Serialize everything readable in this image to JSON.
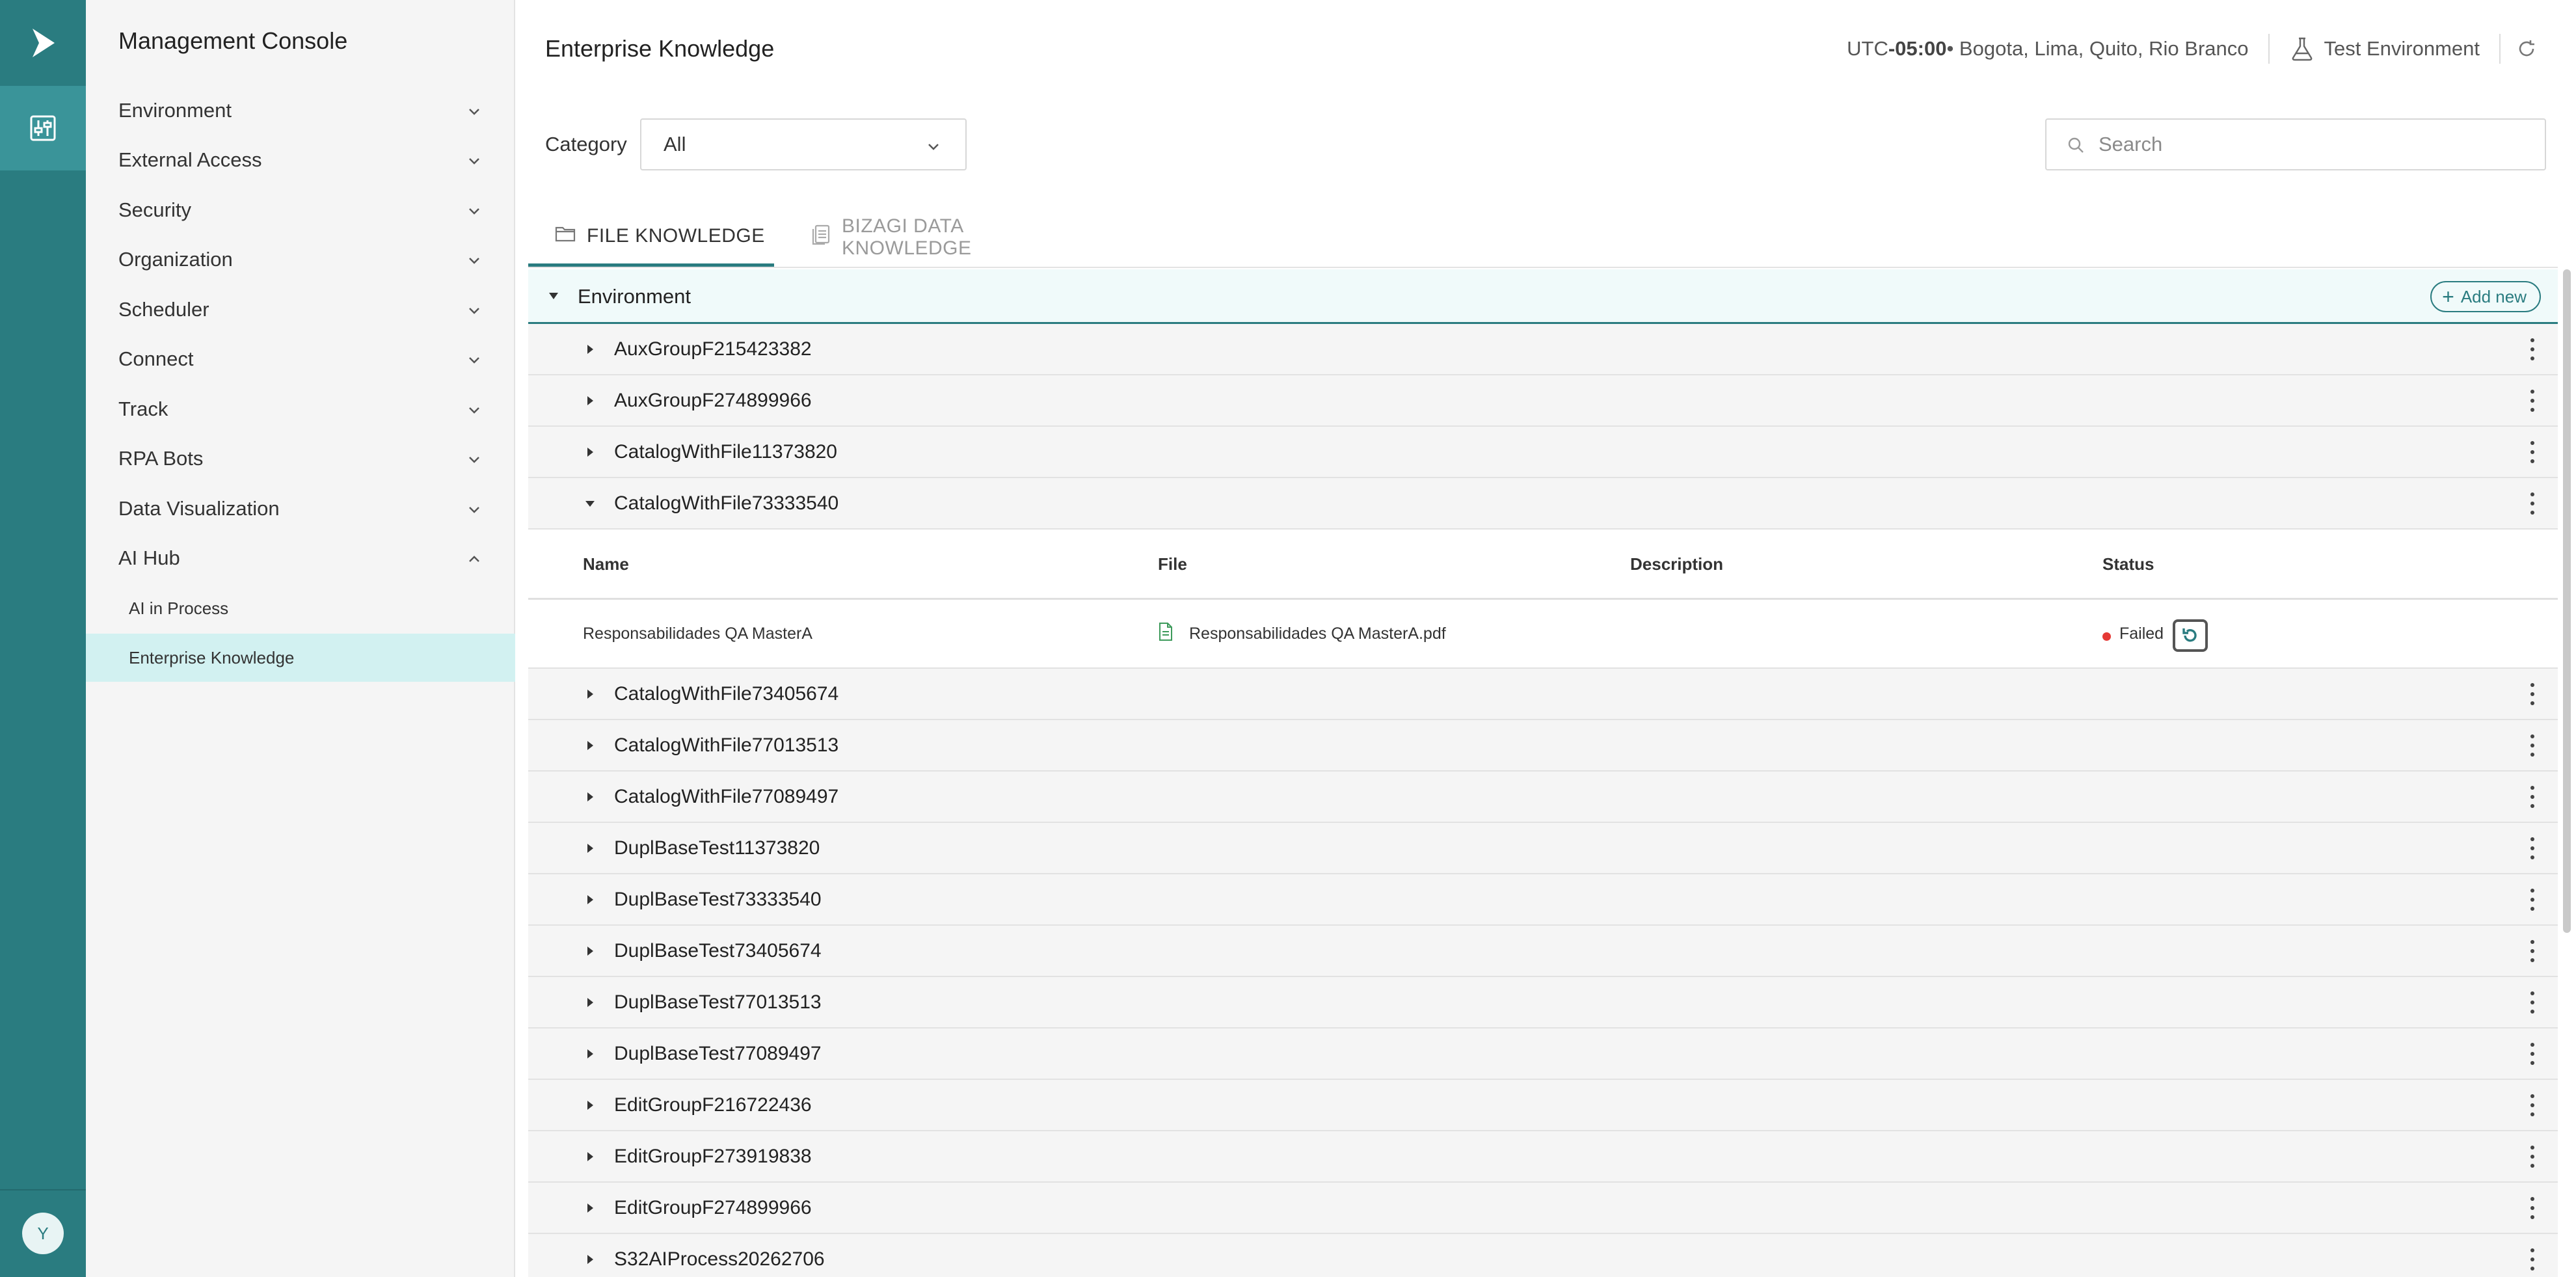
{
  "app": {
    "console_title": "Management Console",
    "avatar_initial": "Y",
    "accent_color": "#2a7c80"
  },
  "sidebar": {
    "items": [
      {
        "label": "Environment"
      },
      {
        "label": "External Access"
      },
      {
        "label": "Security"
      },
      {
        "label": "Organization"
      },
      {
        "label": "Scheduler"
      },
      {
        "label": "Connect"
      },
      {
        "label": "Track"
      },
      {
        "label": "RPA Bots"
      },
      {
        "label": "Data Visualization"
      },
      {
        "label": "AI Hub"
      }
    ],
    "ai_hub_children": [
      {
        "label": "AI in Process"
      },
      {
        "label": "Enterprise Knowledge"
      }
    ]
  },
  "header": {
    "page_title": "Enterprise Knowledge",
    "tz_prefix": "UTC ",
    "tz_offset": "-05:00",
    "tz_cities": " • Bogota, Lima, Quito, Rio Branco",
    "environment": "Test Environment"
  },
  "filters": {
    "category_label": "Category",
    "category_value": "All",
    "search_placeholder": "Search"
  },
  "tabs": [
    {
      "label": "FILE KNOWLEDGE",
      "active": true
    },
    {
      "label": "BIZAGI DATA KNOWLEDGE",
      "active": false
    }
  ],
  "tree": {
    "root_label": "Environment",
    "add_new_label": "Add new",
    "groups_before": [
      "AuxGroupF215423382",
      "AuxGroupF274899966",
      "CatalogWithFile11373820",
      "CatalogWithFile73333540"
    ],
    "expanded_table": {
      "columns": [
        "Name",
        "File",
        "Description",
        "Status"
      ],
      "rows": [
        {
          "name": "Responsabilidades QA MasterA",
          "file": "Responsabilidades QA MasterA.pdf",
          "description": "",
          "status": "Failed",
          "status_color": "#e53935"
        }
      ]
    },
    "groups_after": [
      "CatalogWithFile73405674",
      "CatalogWithFile77013513",
      "CatalogWithFile77089497",
      "DuplBaseTest11373820",
      "DuplBaseTest73333540",
      "DuplBaseTest73405674",
      "DuplBaseTest77013513",
      "DuplBaseTest77089497",
      "EditGroupF216722436",
      "EditGroupF273919838",
      "EditGroupF274899966",
      "S32AIProcess20262706"
    ]
  }
}
